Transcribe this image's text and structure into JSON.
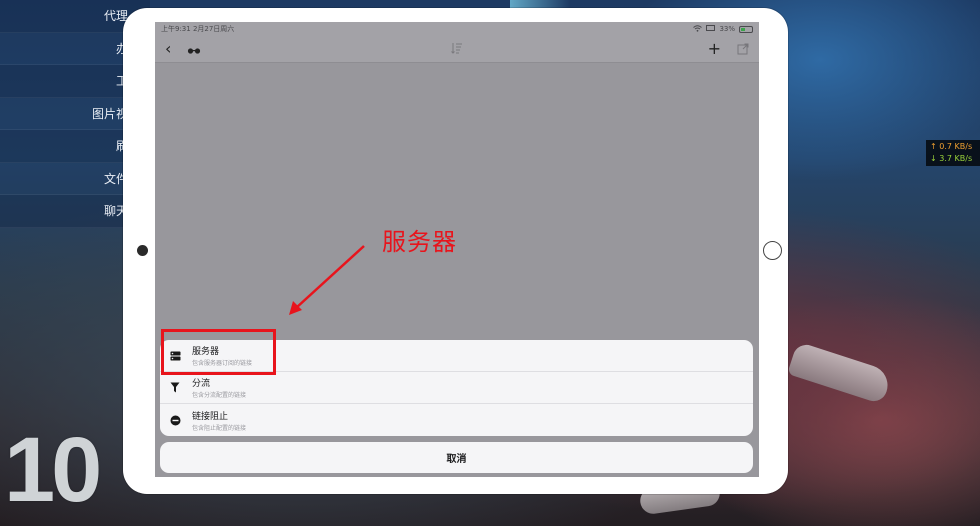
{
  "background": {
    "left_list": [
      "代理",
      "办",
      "工",
      "图片视",
      "刷",
      "文件",
      "聊天"
    ],
    "big_number": "10",
    "net_speed": {
      "up": "↑ 0.7 KB/s",
      "down": "↓ 3.7 KB/s"
    }
  },
  "statusbar": {
    "time_date": "上午9:31   2月27日周六",
    "battery": "33%"
  },
  "navbar": {
    "back_icon": "‹",
    "proxy_icon": "glasses-icon",
    "sort_icon": "sort-icon",
    "add_icon": "+",
    "share_icon": "share-icon"
  },
  "action_sheet": {
    "items": [
      {
        "title": "服务器",
        "subtitle": "包含服务器订阅的链接",
        "icon": "server-icon"
      },
      {
        "title": "分流",
        "subtitle": "包含分流配置的链接",
        "icon": "funnel-icon"
      },
      {
        "title": "链接阻止",
        "subtitle": "包含阻止配置的链接",
        "icon": "block-icon"
      }
    ],
    "cancel_label": "取消"
  },
  "annotation": {
    "label": "服务器",
    "color": "#e8141c"
  }
}
